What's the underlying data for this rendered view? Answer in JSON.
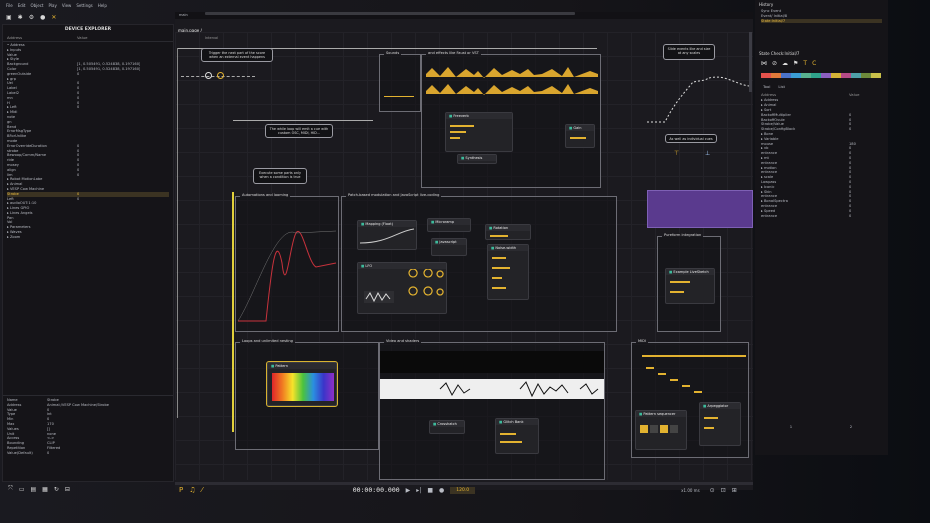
{
  "menu": [
    "File",
    "Edit",
    "Object",
    "Play",
    "View",
    "Settings",
    "Help"
  ],
  "device_explorer": {
    "title": "DEVICE EXPLORER",
    "col_address": "Address",
    "col_value": "Value",
    "tree": [
      {
        "k": "• Address",
        "v": ""
      },
      {
        "k": "  ▸ Inputs",
        "v": ""
      },
      {
        "k": "  Value",
        "v": ""
      },
      {
        "k": "  ▸ Style",
        "v": ""
      },
      {
        "k": "    Background",
        "v": "[1, 0.505491, 0.524838, 0.197160]"
      },
      {
        "k": "    Color",
        "v": "[1, 0.505491, 0.524838, 0.197160]"
      },
      {
        "k": "    greenOutside",
        "v": "0"
      },
      {
        "k": "  ▸ grp",
        "v": ""
      },
      {
        "k": "    Uei",
        "v": "0"
      },
      {
        "k": "    Label",
        "v": "0"
      },
      {
        "k": "    Label2",
        "v": "0"
      },
      {
        "k": "    mn",
        "v": "0"
      },
      {
        "k": "    H",
        "v": "0"
      },
      {
        "k": "  ▸ Left",
        "v": "0"
      },
      {
        "k": "  ▸ Midi",
        "v": ""
      },
      {
        "k": "    note",
        "v": ""
      },
      {
        "k": "    gn",
        "v": ""
      },
      {
        "k": "    Bend",
        "v": ""
      },
      {
        "k": "    ErrorMsgType",
        "v": ""
      },
      {
        "k": "    BForUnlike",
        "v": ""
      },
      {
        "k": "    mode",
        "v": ""
      },
      {
        "k": "    ErrorOverrideDuration",
        "v": "0"
      },
      {
        "k": "    strobe",
        "v": "0"
      },
      {
        "k": "    Bewoop/Comm/Name",
        "v": "0"
      },
      {
        "k": "    ride",
        "v": "0"
      },
      {
        "k": "    mosey",
        "v": "0"
      },
      {
        "k": "    align",
        "v": "0"
      },
      {
        "k": "    lim",
        "v": "0"
      },
      {
        "k": "  ▸ Robot MotionLabe",
        "v": ""
      },
      {
        "k": "  ▸ Animal",
        "v": ""
      },
      {
        "k": "    ▸ VESP Cow Machine",
        "v": ""
      },
      {
        "k": "      Strobe",
        "v": "0",
        "sel": true
      },
      {
        "k": "      Left",
        "v": "0"
      },
      {
        "k": "    ▸ audioOUT:1:10",
        "v": ""
      },
      {
        "k": "      ▸ Lines GPIO",
        "v": ""
      },
      {
        "k": "      ▸ Lines Angels",
        "v": ""
      },
      {
        "k": "        Pan",
        "v": ""
      },
      {
        "k": "        Vol",
        "v": ""
      },
      {
        "k": "      ▸ Parameters",
        "v": ""
      },
      {
        "k": "      ▸ Waves",
        "v": ""
      },
      {
        "k": "      ▸ Zoom",
        "v": ""
      }
    ],
    "props": [
      {
        "k": "Name",
        "v": "Strobe"
      },
      {
        "k": "Address",
        "v": "Animal:/VESP Cow Machine/Strobe"
      },
      {
        "k": "Value",
        "v": "0"
      },
      {
        "k": "Type",
        "v": "int"
      },
      {
        "k": "Min",
        "v": "0"
      },
      {
        "k": "Max",
        "v": "170"
      },
      {
        "k": "Values",
        "v": "[]"
      },
      {
        "k": "Unit",
        "v": "none"
      },
      {
        "k": "Access",
        "v": "<->"
      },
      {
        "k": "Bounding",
        "v": "CLIP"
      },
      {
        "k": "Repetition",
        "v": "Filtered"
      },
      {
        "k": "Value(Default)",
        "v": "0"
      }
    ]
  },
  "canvas": {
    "tab": "main",
    "breadcrumb": "main.page /",
    "interval": "Interval",
    "boxes": {
      "sounds": "Sounds",
      "effects": "and effects like Faust or VST",
      "automations": "Automations and looming",
      "patch": "Patch-based modulation and JavaScript live-coding",
      "pureform": "Pureform integration",
      "loops": "Loops and unlimited nesting",
      "video": "Video and shaders",
      "midi": "MIDI"
    },
    "notes": {
      "trigger": "Trigger the next part of the score when an external event happens",
      "while": "The while loop will emit a cue with custom OSC, MIDI, HID...",
      "slide": "Slide events like and size at any scales",
      "execute": "Execute some parts only when a condition is true",
      "individual": "As well as individual cues"
    },
    "nodes": {
      "freeverb": "Freeverb",
      "gain": "Gain",
      "synthesis": "Synthesis",
      "mapping": "Mapping (Float)",
      "microramp": "Microramp",
      "envelope": "Javascript",
      "rotation": "Rotation",
      "noise": "Noise-width",
      "lfo": "LFO",
      "pattern": "Pattern",
      "crosshatch": "Crosshatch",
      "glitch": "Glitch Bank",
      "pattern_seq": "Pattern sequencer",
      "arpeggiator": "Arpeggiator",
      "example": "Example LiveSketch"
    }
  },
  "right_panel": {
    "title1": "History",
    "items": [
      "Sync Event",
      "Event/ Initial/8",
      "State:Initial/7"
    ],
    "title2": "State Check:Initial/7",
    "tabs": [
      "Tool",
      "List"
    ],
    "col_address": "Address",
    "col_value": "Value",
    "tree": [
      {
        "k": "▸ Address",
        "v": ""
      },
      {
        "k": "  ▸ Animal",
        "v": ""
      },
      {
        "k": "    ▸ Sort",
        "v": ""
      },
      {
        "k": "      BackoffMultiplier",
        "v": "0"
      },
      {
        "k": "      BackoffOvule",
        "v": "0"
      },
      {
        "k": "      Strobe/Value",
        "v": "0"
      },
      {
        "k": "      Strobe/ConfigBlock",
        "v": "0"
      },
      {
        "k": "    ▸ Bone",
        "v": ""
      },
      {
        "k": "      ▸ Variable",
        "v": ""
      },
      {
        "k": "        mouse",
        "v": "180"
      },
      {
        "k": "      ▸ vb",
        "v": "0"
      },
      {
        "k": "        entrance",
        "v": "0"
      },
      {
        "k": "      ▸ mt",
        "v": "0"
      },
      {
        "k": "        entrance",
        "v": "0"
      },
      {
        "k": "      ▸ motion",
        "v": "0"
      },
      {
        "k": "        entrance",
        "v": "0"
      },
      {
        "k": "      ▸ scale",
        "v": "0"
      },
      {
        "k": "        Lowpass",
        "v": "0"
      },
      {
        "k": "      ▸ Iconic",
        "v": "0"
      },
      {
        "k": "        ▸ Skin",
        "v": "0"
      },
      {
        "k": "          entrance",
        "v": "0"
      },
      {
        "k": "        ▸ BonalSpectra",
        "v": "0"
      },
      {
        "k": "          entrance",
        "v": "0"
      },
      {
        "k": "        ▸ Speed",
        "v": "0"
      },
      {
        "k": "          entrance",
        "v": "0"
      }
    ],
    "footer_a": "1",
    "footer_b": "2"
  },
  "palette": [
    "#e4524c",
    "#e07a3a",
    "#4b73c9",
    "#3a9dd4",
    "#58b18e",
    "#2fa38b",
    "#8b5fbf",
    "#d4b337",
    "#b54b86",
    "#4fa0a8",
    "#6d8a3b",
    "#c9c04a"
  ],
  "transport": {
    "time": "00:00:00.000",
    "tempo": "120.0",
    "zoom": "x1.00 ms"
  }
}
